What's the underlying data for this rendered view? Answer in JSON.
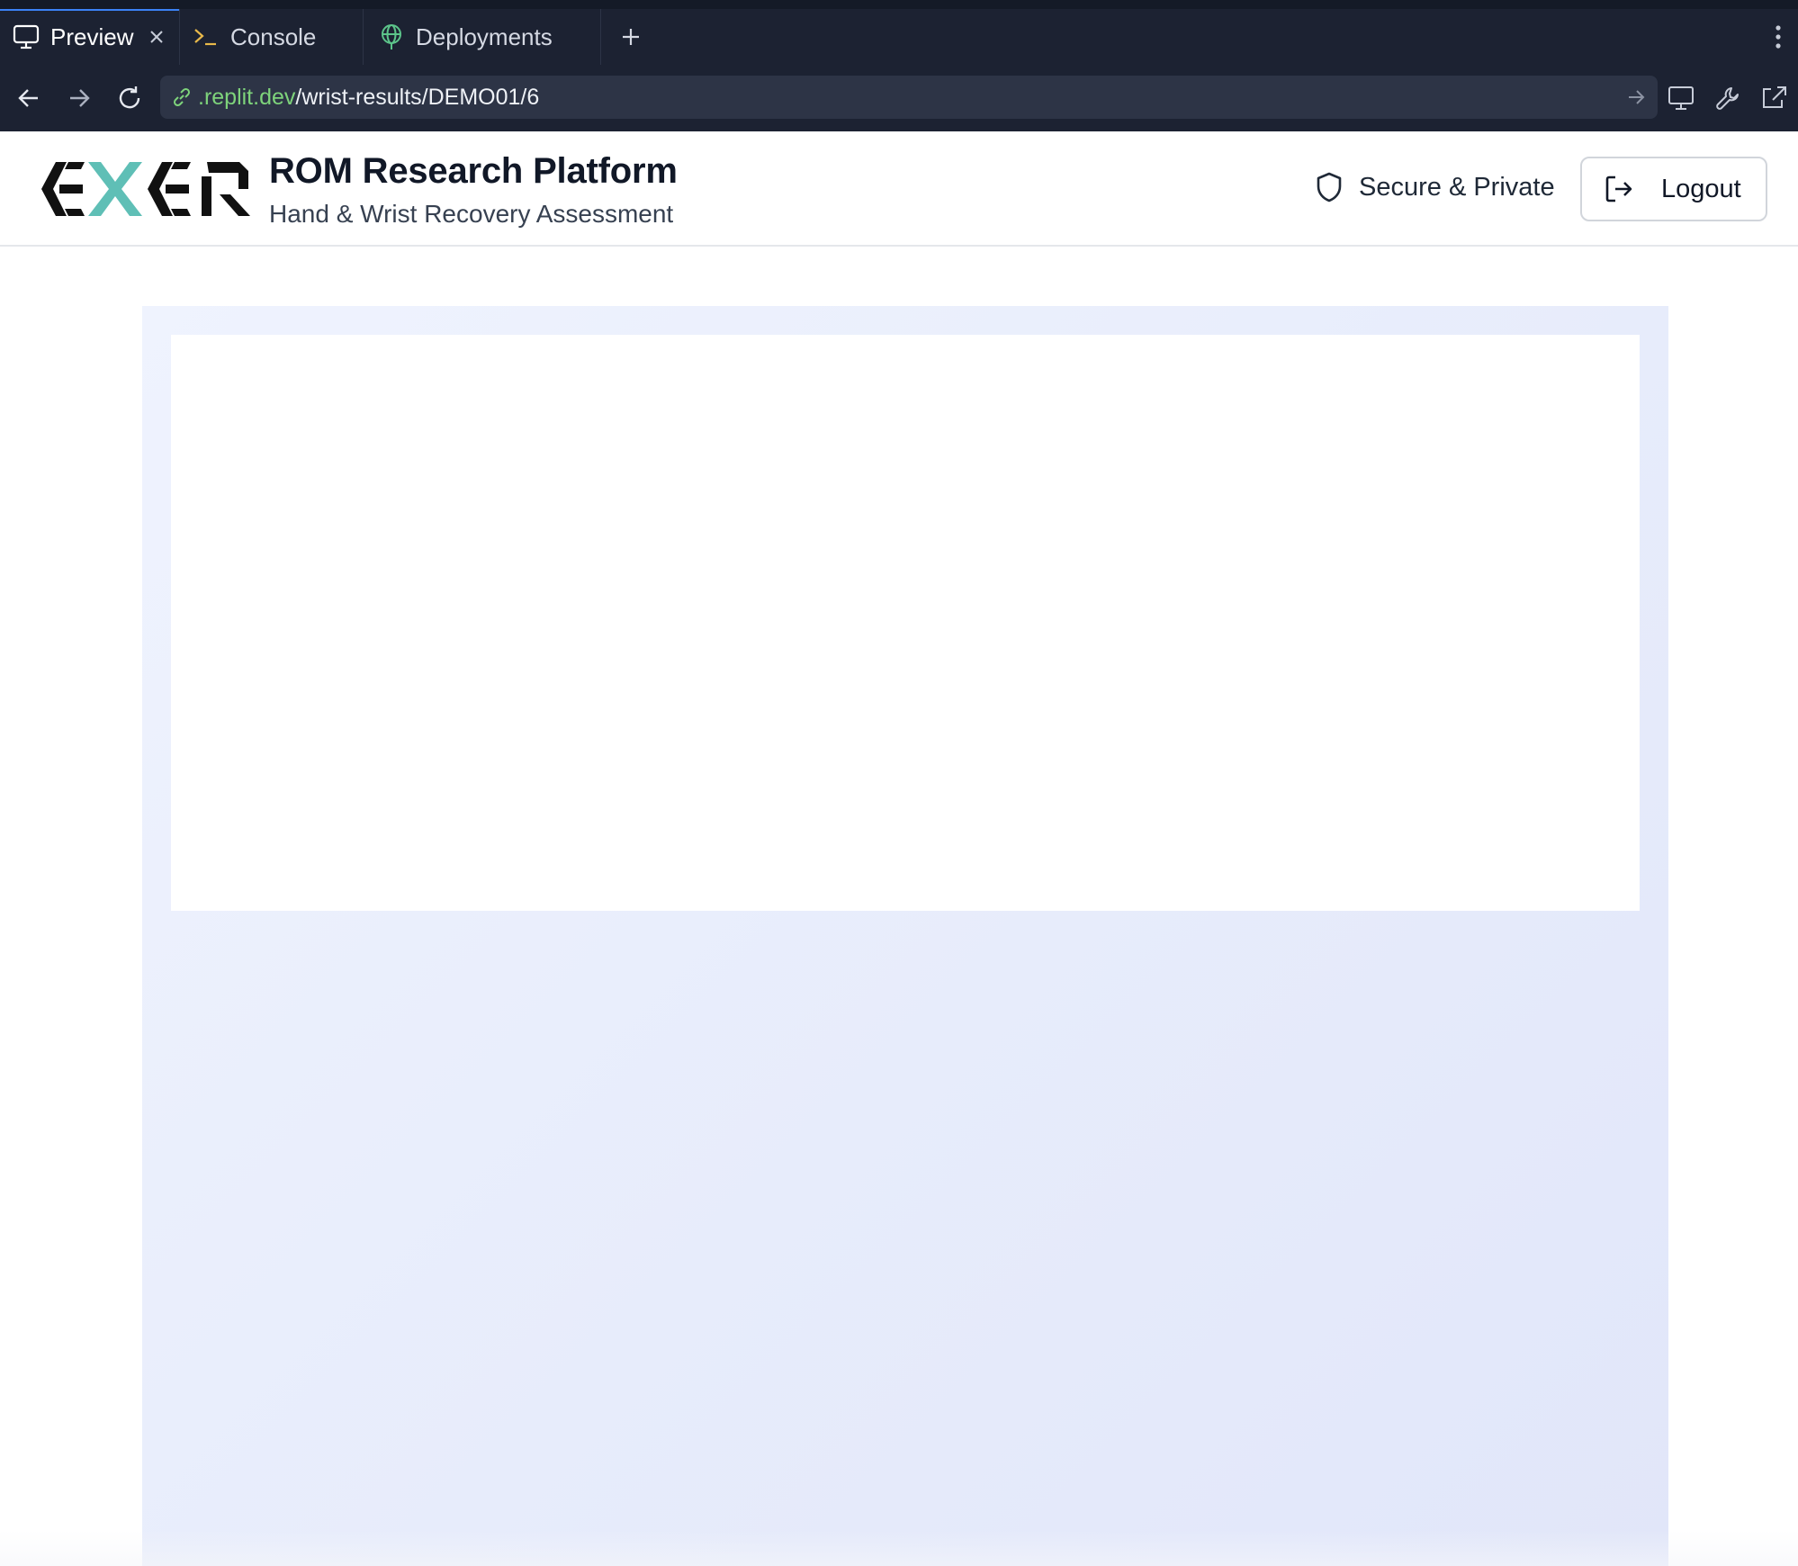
{
  "browser": {
    "tabs": [
      {
        "label": "Preview",
        "icon": "monitor-icon",
        "active": true,
        "closable": true
      },
      {
        "label": "Console",
        "icon": "terminal-icon",
        "active": false
      },
      {
        "label": "Deployments",
        "icon": "globe-icon",
        "active": false
      }
    ],
    "url": {
      "domain": ".replit.dev",
      "path": "/wrist-results/DEMO01/6"
    }
  },
  "header": {
    "logo_text": "EXER",
    "title": "ROM Research Platform",
    "subtitle": "Hand & Wrist Recovery Assessment",
    "secure_label": "Secure & Private",
    "logout_label": "Logout"
  },
  "colors": {
    "chrome_bg": "#1c2232",
    "url_domain": "#7ed37b",
    "logo_dark": "#111111",
    "logo_accent": "#5fbfb6",
    "content_bg": "#e9eefc",
    "active_tab_accent": "#3b82f6"
  }
}
